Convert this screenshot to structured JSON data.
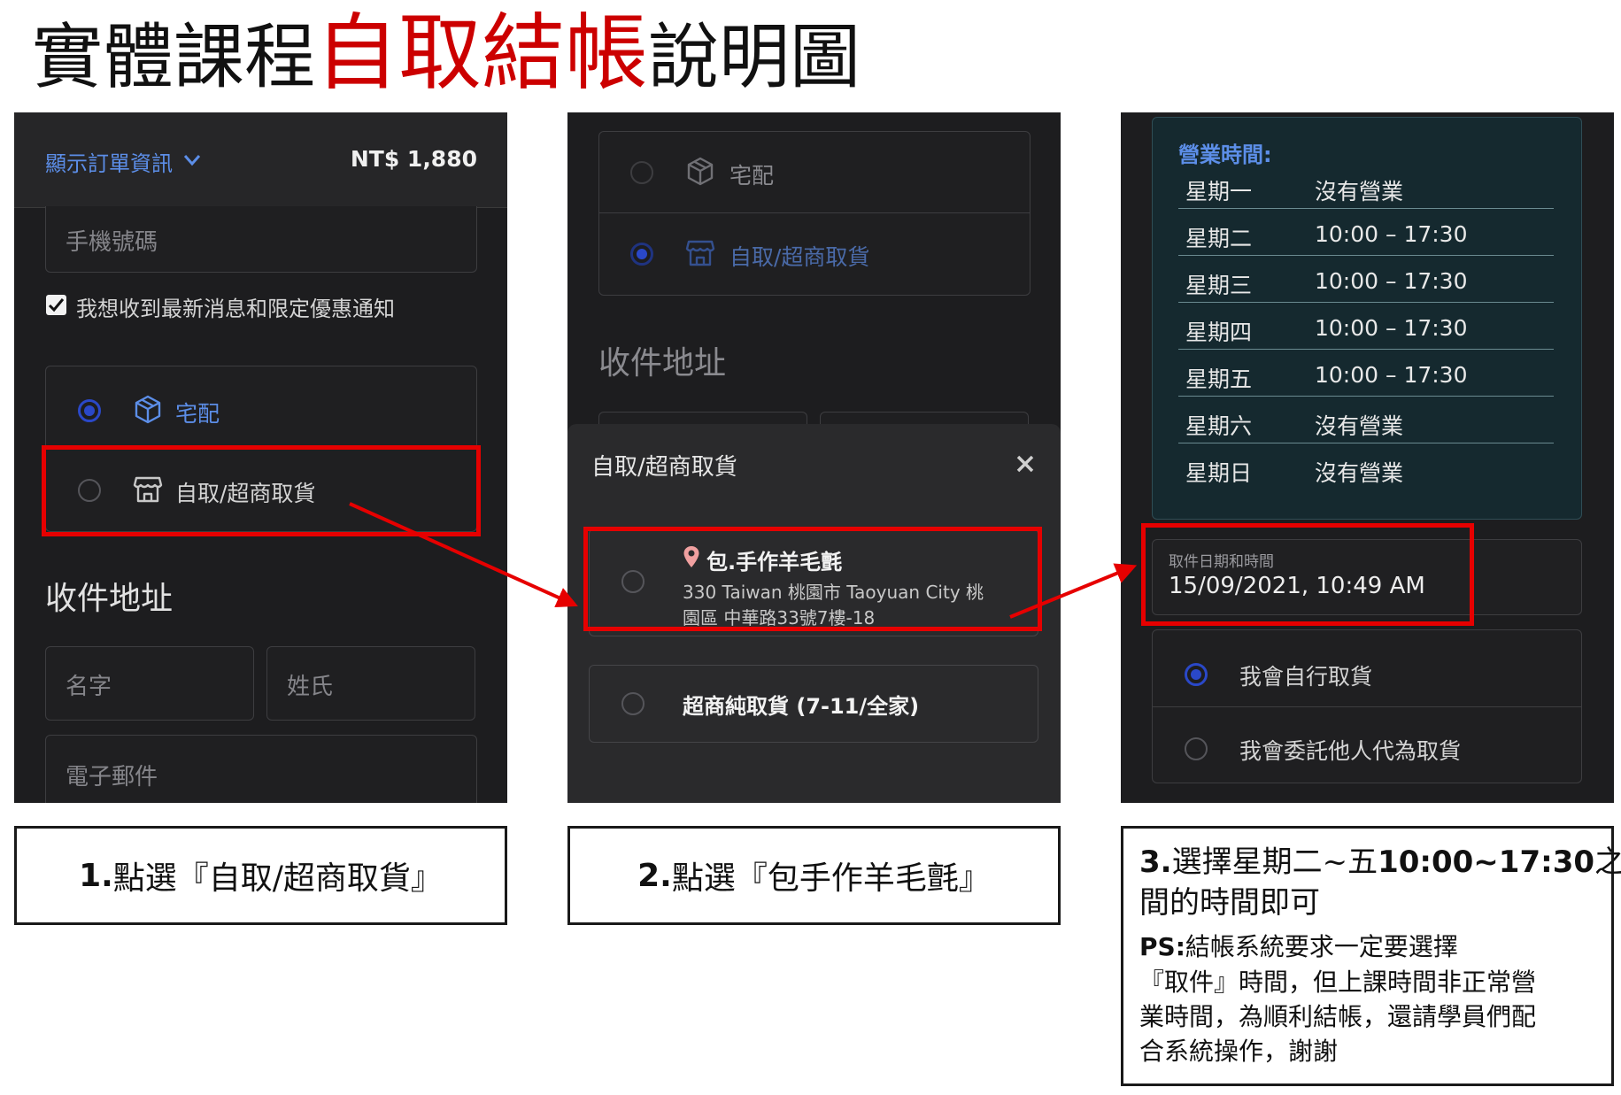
{
  "title": {
    "prefix": "實體課程",
    "highlight": "自取結帳",
    "suffix": "說明圖"
  },
  "colors": {
    "accent_red": "#e60000",
    "radio_blue": "#2a48c8",
    "link_blue": "#5c8ee8",
    "hours_bg": "#15292f"
  },
  "panel1": {
    "order_info_link": "顯示訂單資訊",
    "total": "NT$ 1,880",
    "phone_placeholder": "手機號碼",
    "newsletter_label": "我想收到最新消息和限定優惠通知",
    "newsletter_checked": true,
    "option_delivery": "宅配",
    "option_pickup": "自取/超商取貨",
    "address_heading": "收件地址",
    "first_name_placeholder": "名字",
    "last_name_placeholder": "姓氏",
    "email_placeholder": "電子郵件"
  },
  "panel2": {
    "option_delivery": "宅配",
    "option_pickup": "自取/超商取貨",
    "address_heading": "收件地址",
    "modal_title": "自取/超商取貨",
    "store_name": "包.手作羊毛氈",
    "store_address_line1": "330 Taiwan 桃園市 Taoyuan City 桃",
    "store_address_line2": "園區 中華路33號7樓-18",
    "convenience_option": "超商純取貨 (7-11/全家)"
  },
  "panel3": {
    "hours_heading": "營業時間:",
    "hours": [
      {
        "day": "星期一",
        "time": "沒有營業"
      },
      {
        "day": "星期二",
        "time": "10:00 – 17:30"
      },
      {
        "day": "星期三",
        "time": "10:00 – 17:30"
      },
      {
        "day": "星期四",
        "time": "10:00 – 17:30"
      },
      {
        "day": "星期五",
        "time": "10:00 – 17:30"
      },
      {
        "day": "星期六",
        "time": "沒有營業"
      },
      {
        "day": "星期日",
        "time": "沒有營業"
      }
    ],
    "pickup_datetime_label": "取件日期和時間",
    "pickup_datetime_value": "15/09/2021, 10:49 AM",
    "option_self": "我會自行取貨",
    "option_proxy": "我會委託他人代為取貨"
  },
  "captions": {
    "step1_num": "1.",
    "step1_text": "點選『自取/超商取貨』",
    "step2_num": "2.",
    "step2_text": "點選『包手作羊毛氈』",
    "step3_num": "3.",
    "step3_a": "選擇星期二~五",
    "step3_time": "10:00~17:30",
    "step3_b": "之",
    "step3_line2": "間的時間即可",
    "ps_label": "PS:",
    "ps_line1": "結帳系統要求一定要選擇",
    "ps_line2": "『取件』時間，但上課時間非正常營",
    "ps_line3": "業時間，為順利結帳，還請學員們配",
    "ps_line4": "合系統操作，謝謝"
  }
}
